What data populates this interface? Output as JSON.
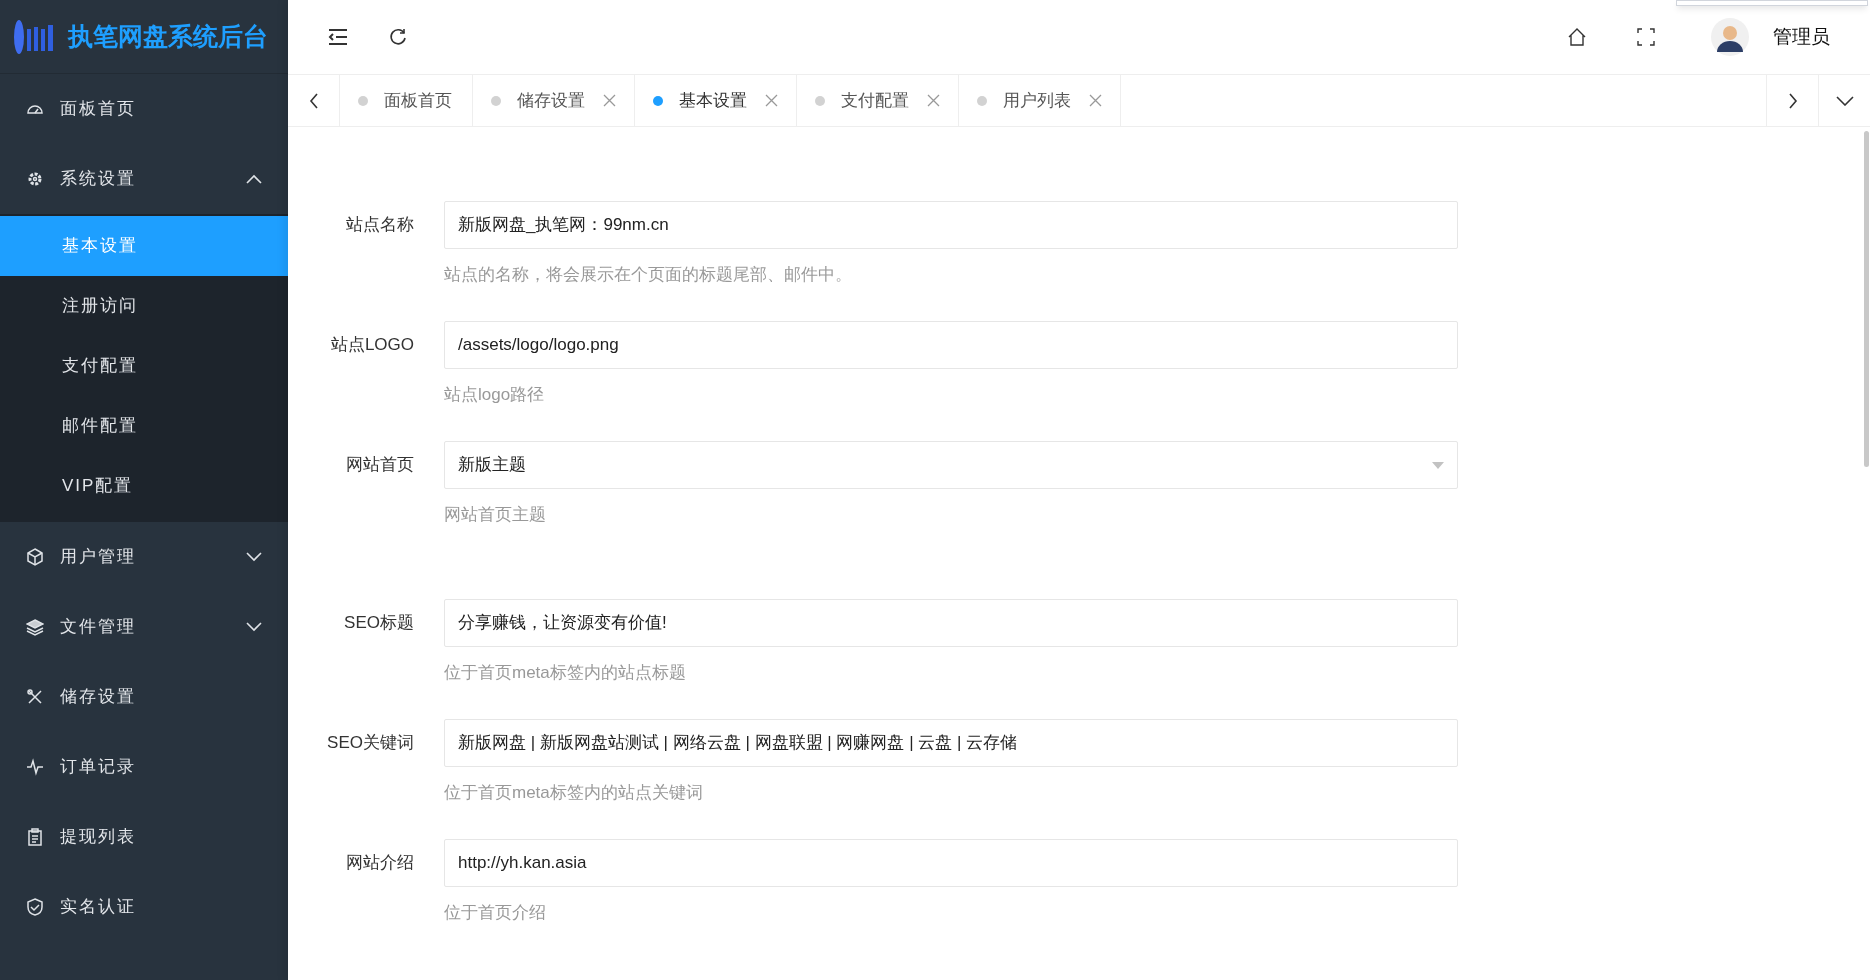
{
  "logo": {
    "title": "执笔网盘系统后台"
  },
  "header": {
    "user": "管理员"
  },
  "sidebar": {
    "items": [
      {
        "label": "面板首页",
        "selected": false
      },
      {
        "label": "系统设置",
        "selected": false,
        "expanded": true,
        "children": [
          {
            "label": "基本设置",
            "selected": true
          },
          {
            "label": "注册访问",
            "selected": false
          },
          {
            "label": "支付配置",
            "selected": false
          },
          {
            "label": "邮件配置",
            "selected": false
          },
          {
            "label": "VIP配置",
            "selected": false
          }
        ]
      },
      {
        "label": "用户管理",
        "selected": false,
        "expanded": false
      },
      {
        "label": "文件管理",
        "selected": false,
        "expanded": false
      },
      {
        "label": "储存设置",
        "selected": false
      },
      {
        "label": "订单记录",
        "selected": false
      },
      {
        "label": "提现列表",
        "selected": false
      },
      {
        "label": "实名认证",
        "selected": false
      }
    ]
  },
  "tabs": [
    {
      "label": "面板首页",
      "selected": false,
      "closable": false
    },
    {
      "label": "储存设置",
      "selected": false,
      "closable": true
    },
    {
      "label": "基本设置",
      "selected": true,
      "closable": true
    },
    {
      "label": "支付配置",
      "selected": false,
      "closable": true
    },
    {
      "label": "用户列表",
      "selected": false,
      "closable": true
    }
  ],
  "form": {
    "sections": [
      [
        {
          "kind": "text",
          "label": "站点名称",
          "value": "新版网盘_执笔网：99nm.cn",
          "hint": "站点的名称，将会展示在个页面的标题尾部、邮件中。"
        },
        {
          "kind": "text",
          "label": "站点LOGO",
          "value": "/assets/logo/logo.png",
          "hint": "站点logo路径"
        },
        {
          "kind": "select",
          "label": "网站首页",
          "value": "新版主题",
          "hint": "网站首页主题"
        }
      ],
      [
        {
          "kind": "text",
          "label": "SEO标题",
          "value": "分享赚钱，让资源变有价值!",
          "hint": "位于首页meta标签内的站点标题"
        },
        {
          "kind": "text",
          "label": "SEO关键词",
          "value": "新版网盘 | 新版网盘站测试 | 网络云盘 | 网盘联盟 | 网赚网盘 | 云盘 | 云存储",
          "hint": "位于首页meta标签内的站点关键词"
        },
        {
          "kind": "text",
          "label": "网站介绍",
          "value": "http://yh.kan.asia",
          "hint": "位于首页介绍"
        }
      ]
    ]
  }
}
